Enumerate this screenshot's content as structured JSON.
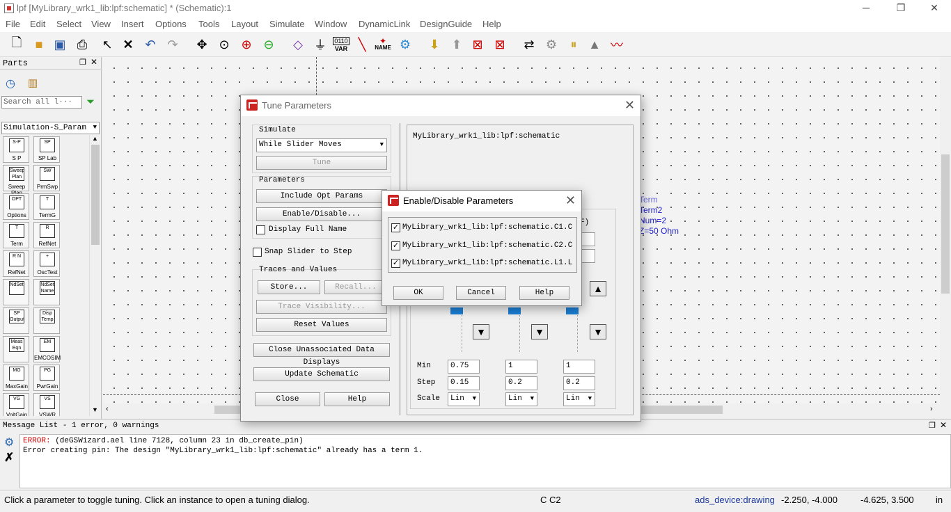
{
  "window": {
    "title": "lpf [MyLibrary_wrk1_lib:lpf:schematic] * (Schematic):1",
    "minimize": "─",
    "restore": "❐",
    "close": "✕"
  },
  "menu": [
    "File",
    "Edit",
    "Select",
    "View",
    "Insert",
    "Options",
    "Tools",
    "Layout",
    "Simulate",
    "Window",
    "DynamicLink",
    "DesignGuide",
    "Help"
  ],
  "toolbar": {
    "var_label": "VAR",
    "var_top": "0110",
    "name_label": "NAME"
  },
  "parts": {
    "title": "Parts",
    "search_placeholder": "Search all l···",
    "library": "Simulation-S_Param",
    "items": [
      {
        "icon": "S-P",
        "label": "S P"
      },
      {
        "icon": "SP",
        "label": "SP Lab"
      },
      {
        "icon": "Sweep Plan",
        "label": "Sweep Plan"
      },
      {
        "icon": "SW",
        "label": "PrmSwp"
      },
      {
        "icon": "OPT",
        "label": "Options"
      },
      {
        "icon": "T",
        "label": "TermG"
      },
      {
        "icon": "T",
        "label": "Term"
      },
      {
        "icon": "R",
        "label": "RefNet"
      },
      {
        "icon": "R N",
        "label": "RefNet"
      },
      {
        "icon": "+",
        "label": "OscTest"
      },
      {
        "icon": "NdSet",
        "label": ""
      },
      {
        "icon": "NdSet Name",
        "label": ""
      },
      {
        "icon": "SP Output",
        "label": ""
      },
      {
        "icon": "Disp Temp",
        "label": ""
      },
      {
        "icon": "Meas Eqn",
        "label": ""
      },
      {
        "icon": "EM",
        "label": "EMCOSIM"
      },
      {
        "icon": "MG",
        "label": "MaxGain"
      },
      {
        "icon": "PG",
        "label": "PwrGain"
      },
      {
        "icon": "VG",
        "label": "VoltGain"
      },
      {
        "icon": "VS",
        "label": "VSWR"
      }
    ]
  },
  "canvas": {
    "term_lines": [
      "Term",
      "Term2",
      "Num=2",
      "Z=50 Ohm"
    ]
  },
  "tune": {
    "title": "Tune Parameters",
    "simulate_label": "Simulate",
    "simulate_mode": "While Slider Moves",
    "tune_btn": "Tune",
    "parameters_label": "Parameters",
    "include_opt": "Include Opt Params",
    "enable_disable": "Enable/Disable...",
    "display_full_name": "Display Full Name",
    "snap_slider": "Snap Slider to Step",
    "traces_label": "Traces and Values",
    "store": "Store...",
    "recall": "Recall...",
    "trace_visibility": "Trace Visibility...",
    "reset_values": "Reset Values",
    "close_unassoc": "Close Unassociated Data Displays",
    "update_schematic": "Update Schematic",
    "close": "Close",
    "help": "Help",
    "design_name": "MyLibrary_wrk1_lib:lpf:schematic",
    "col_header_partial": "F)",
    "row_labels": {
      "min": "Min",
      "step": "Step",
      "scale": "Scale"
    },
    "columns": [
      {
        "min": "0.75",
        "step": "0.15",
        "scale": "Lin"
      },
      {
        "min": "1",
        "step": "0.2",
        "scale": "Lin"
      },
      {
        "min": "1",
        "step": "0.2",
        "scale": "Lin"
      }
    ]
  },
  "enable": {
    "title": "Enable/Disable Parameters",
    "items": [
      {
        "label": "MyLibrary_wrk1_lib:lpf:schematic.C1.C",
        "checked": "✓"
      },
      {
        "label": "MyLibrary_wrk1_lib:lpf:schematic.C2.C",
        "checked": "✓"
      },
      {
        "label": "MyLibrary_wrk1_lib:lpf:schematic.L1.L",
        "checked": "✓"
      }
    ],
    "ok": "OK",
    "cancel": "Cancel",
    "help": "Help"
  },
  "messages": {
    "title": "Message List - 1 error, 0 warnings",
    "error_prefix": "ERROR:",
    "line1": " (deGSWizard.ael line 7128, column 23 in db_create_pin)",
    "line2": "Error creating pin: The design \"MyLibrary_wrk1_lib:lpf:schematic\" already has a term 1."
  },
  "status": {
    "hint": "Click a parameter to toggle tuning. Click an instance to open a tuning dialog.",
    "selection": "C C2",
    "layer": "ads_device:drawing",
    "coords": "-2.250, -4.000",
    "coords2": "-4.625, 3.500",
    "units": "in"
  }
}
